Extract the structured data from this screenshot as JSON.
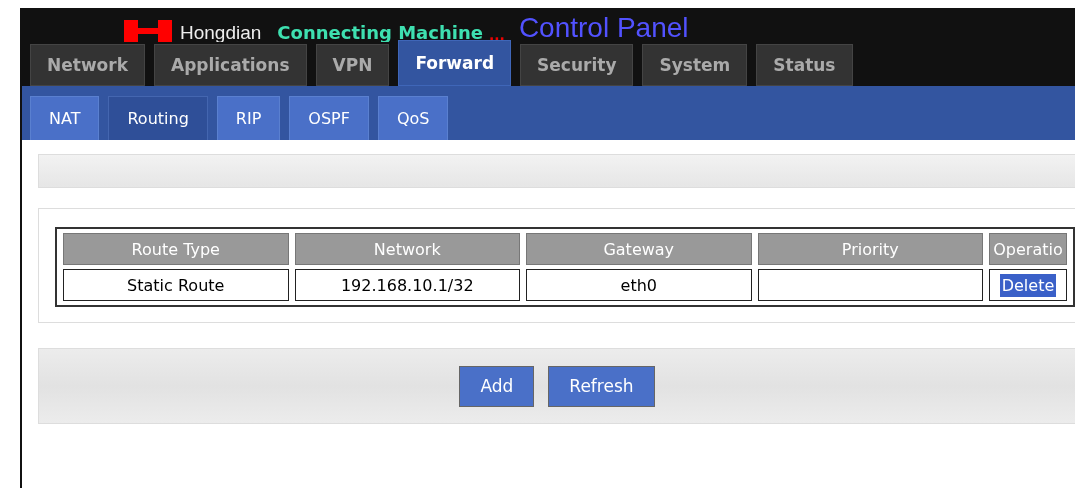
{
  "header": {
    "brand": "Hongdian",
    "tagline": "Connecting Machine",
    "ellipsis": "...",
    "title": "Control Panel"
  },
  "tabs": [
    {
      "label": "Network",
      "selected": false
    },
    {
      "label": "Applications",
      "selected": false
    },
    {
      "label": "VPN",
      "selected": false
    },
    {
      "label": "Forward",
      "selected": true
    },
    {
      "label": "Security",
      "selected": false
    },
    {
      "label": "System",
      "selected": false
    },
    {
      "label": "Status",
      "selected": false
    }
  ],
  "subtabs": [
    {
      "label": "NAT",
      "selected": false
    },
    {
      "label": "Routing",
      "selected": true
    },
    {
      "label": "RIP",
      "selected": false
    },
    {
      "label": "OSPF",
      "selected": false
    },
    {
      "label": "QoS",
      "selected": false
    }
  ],
  "table": {
    "columns": [
      "Route Type",
      "Network",
      "Gateway",
      "Priority",
      "Operatio"
    ],
    "rows": [
      {
        "cells": [
          "Static Route",
          "192.168.10.1/32",
          "eth0",
          ""
        ],
        "action": "Delete"
      }
    ]
  },
  "buttons": [
    "Add",
    "Refresh"
  ]
}
